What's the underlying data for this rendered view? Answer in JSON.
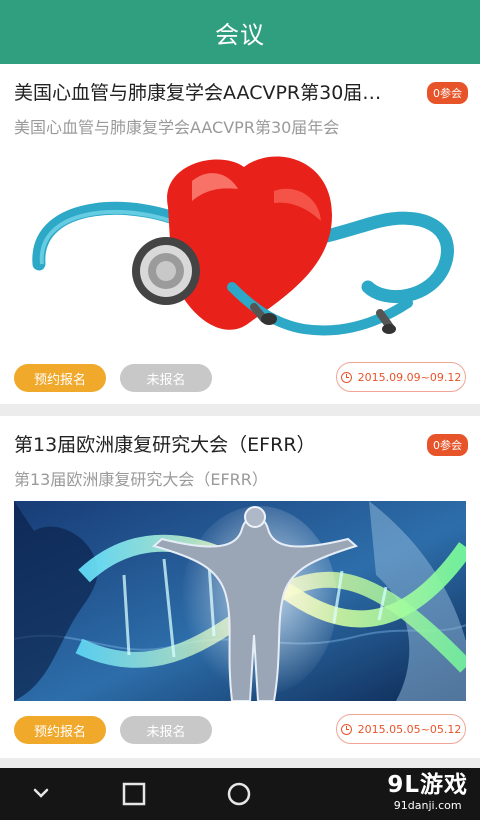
{
  "header": {
    "title": "会议"
  },
  "meetings": [
    {
      "title": "美国心血管与肺康复学会AACVPR第30届…",
      "subtitle": "美国心血管与肺康复学会AACVPR第30届年会",
      "badge": "0参会",
      "reserve_label": "预约报名",
      "status_label": "未报名",
      "date_range": "2015.09.09~09.12",
      "image": "heart-stethoscope"
    },
    {
      "title": "第13届欧洲康复研究大会（EFRR）",
      "subtitle": "第13届欧洲康复研究大会（EFRR）",
      "badge": "0参会",
      "reserve_label": "预约报名",
      "status_label": "未报名",
      "date_range": "2015.05.05~05.12",
      "image": "anatomy-dna"
    }
  ],
  "watermark": {
    "logo": "9L游戏",
    "site": "91danji.com"
  },
  "colors": {
    "header": "#2f9f80",
    "accent": "#e8542a",
    "reserve": "#f1a92c",
    "disabled": "#c8c8c8"
  }
}
